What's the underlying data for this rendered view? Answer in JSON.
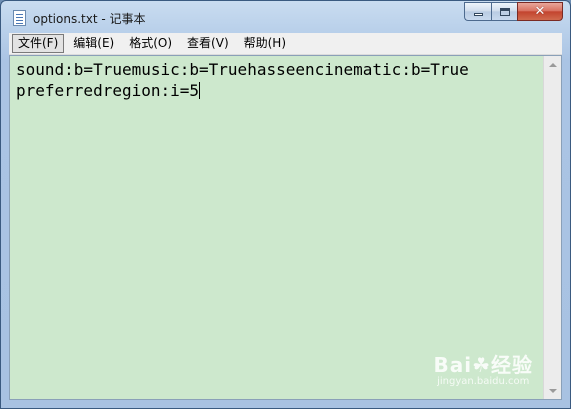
{
  "window": {
    "title": "options.txt - 记事本"
  },
  "menu": {
    "items": [
      "文件(F)",
      "编辑(E)",
      "格式(O)",
      "查看(V)",
      "帮助(H)"
    ]
  },
  "editor": {
    "line1": "sound:b=Truemusic:b=Truehasseencinematic:b=True",
    "line2": "preferredregion:i=5"
  },
  "watermark": {
    "logo": "Bai☘经验",
    "url": "jingyan.baidu.com"
  },
  "icons": {
    "file": "notepad-icon",
    "minimize": "minimize-icon",
    "maximize": "maximize-icon",
    "close": "close-icon"
  }
}
